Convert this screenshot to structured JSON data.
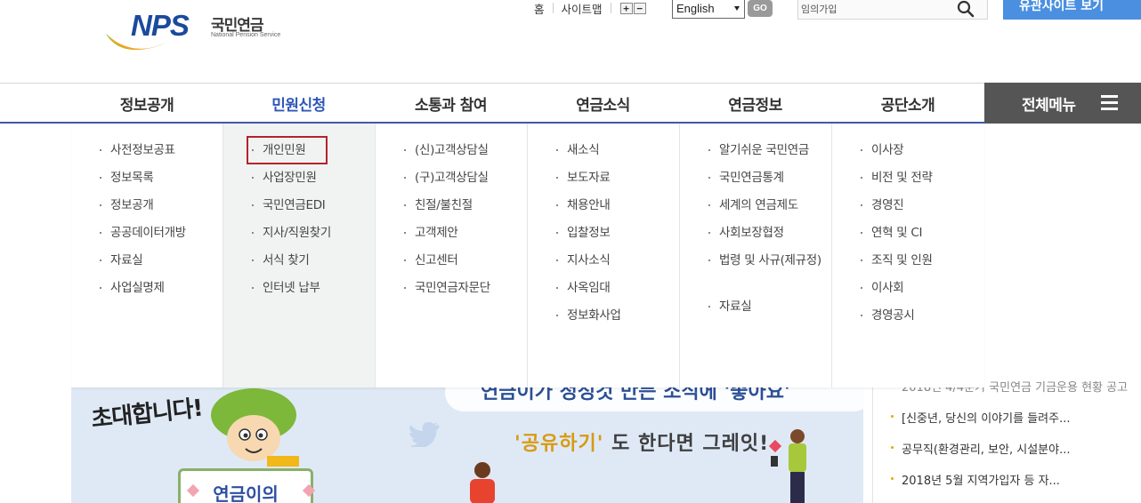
{
  "logo": {
    "brand": "NPS",
    "name_ko": "국민연금",
    "name_en": "National Pension Service"
  },
  "util_links": [
    "홈",
    "사이트맵"
  ],
  "zoom": {
    "in": "+",
    "out": "−"
  },
  "language": {
    "selected": "English",
    "go_label": "GO"
  },
  "search": {
    "placeholder": "임의가입"
  },
  "related_sites_label": "유관사이트 보기",
  "gnb": {
    "items": [
      "정보공개",
      "민원신청",
      "소통과 참여",
      "연금소식",
      "연금정보",
      "공단소개"
    ],
    "active_index": 1,
    "all_menu_label": "전체메뉴"
  },
  "dropdown": {
    "columns": [
      [
        "사전정보공표",
        "정보목록",
        "정보공개",
        "공공데이터개방",
        "자료실",
        "사업실명제"
      ],
      [
        "개인민원",
        "사업장민원",
        "국민연금EDI",
        "지사/직원찾기",
        "서식 찾기",
        "인터넷 납부"
      ],
      [
        "(신)고객상담실",
        "(구)고객상담실",
        "친절/불친절",
        "고객제안",
        "신고센터",
        "국민연금자문단"
      ],
      [
        "새소식",
        "보도자료",
        "채용안내",
        "입찰정보",
        "지사소식",
        "사옥임대",
        "정보화사업"
      ],
      [
        "알기쉬운 국민연금",
        "국민연금통계",
        "세계의 연금제도",
        "사회보장협정",
        "법령 및 사규(제규정)",
        "자료실"
      ],
      [
        "이사장",
        "비전 및 전략",
        "경영진",
        "연혁 및 CI",
        "조직 및 인원",
        "이사회",
        "경영공시"
      ]
    ],
    "highlighted": "개인민원"
  },
  "banner": {
    "text1": "초대합니다!",
    "text2": "연금이가 정성것 만든 소식에 '좋아요'",
    "text3_a": "'공유하기'",
    "text3_b": " 도 한다면 그레잇!",
    "label": "연금이의"
  },
  "news": [
    "2018년 4/4분기 국민연금 기금운용 현황 공고",
    "[신중년, 당신의 이야기를 들려주...",
    "공무직(환경관리, 보안, 시설분야...",
    "2018년 5월 지역가입자 등 자..."
  ],
  "colors": {
    "primary": "#2f57b8",
    "gnb_border": "#3f5aa6",
    "all_menu_bg": "#555555",
    "highlight": "#b3232c",
    "related_btn": "#4a8fe0"
  }
}
